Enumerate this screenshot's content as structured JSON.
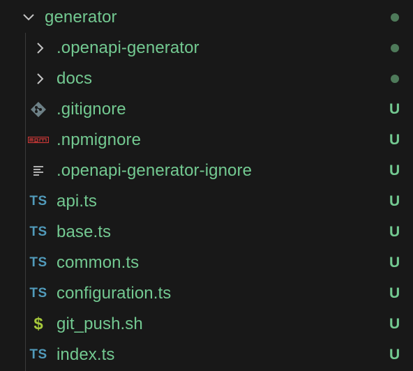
{
  "explorer": {
    "root": {
      "label": "generator",
      "expanded": true,
      "status": "dot"
    },
    "items": [
      {
        "label": ".openapi-generator",
        "kind": "folder",
        "icon": "chevron-right-icon",
        "status": "dot"
      },
      {
        "label": "docs",
        "kind": "folder",
        "icon": "chevron-right-icon",
        "status": "dot"
      },
      {
        "label": ".gitignore",
        "kind": "file",
        "icon": "git-icon",
        "status": "U"
      },
      {
        "label": ".npmignore",
        "kind": "file",
        "icon": "npm-icon",
        "status": "U"
      },
      {
        "label": ".openapi-generator-ignore",
        "kind": "file",
        "icon": "text-lines-icon",
        "status": "U"
      },
      {
        "label": "api.ts",
        "kind": "file",
        "icon": "typescript-icon",
        "status": "U"
      },
      {
        "label": "base.ts",
        "kind": "file",
        "icon": "typescript-icon",
        "status": "U"
      },
      {
        "label": "common.ts",
        "kind": "file",
        "icon": "typescript-icon",
        "status": "U"
      },
      {
        "label": "configuration.ts",
        "kind": "file",
        "icon": "typescript-icon",
        "status": "U"
      },
      {
        "label": "git_push.sh",
        "kind": "file",
        "icon": "shell-dollar-icon",
        "status": "U"
      },
      {
        "label": "index.ts",
        "kind": "file",
        "icon": "typescript-icon",
        "status": "U"
      }
    ],
    "icon_text": {
      "typescript": "TS",
      "shell": "$"
    },
    "colors": {
      "background": "#181818",
      "untracked_text": "#73c991",
      "modified_dot": "#4e7a5a",
      "typescript_icon": "#519aba",
      "shell_icon": "#a6c83b",
      "npm_icon": "#cb3837",
      "git_icon": "#6d8086",
      "chevron": "#c5c5c5"
    }
  }
}
